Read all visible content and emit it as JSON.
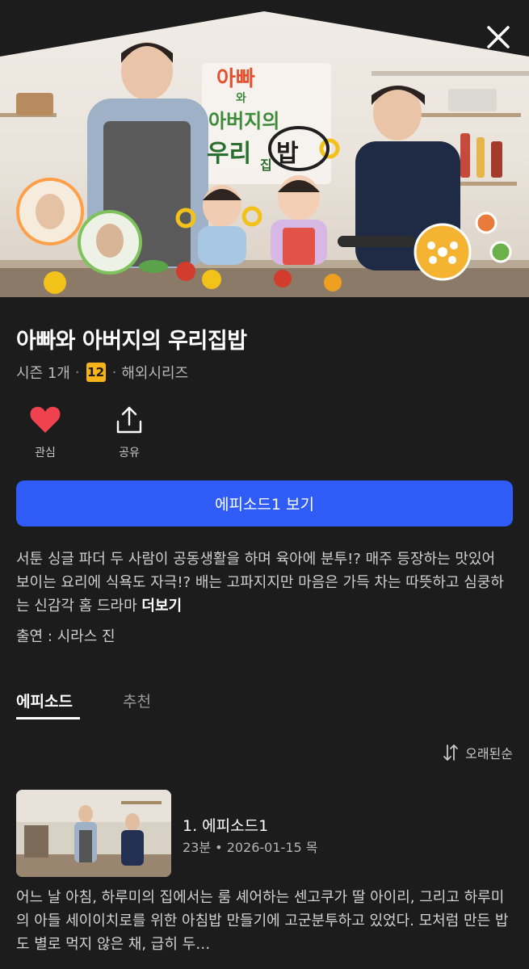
{
  "hero": {
    "logo_lines": [
      "아빠",
      "와",
      "아버지의",
      "우리",
      "집",
      "밥"
    ]
  },
  "show": {
    "title": "아빠와 아버지의 우리집밥",
    "seasons": "시즌 1개",
    "age_rating": "12",
    "category": "해외시리즈"
  },
  "actions": {
    "like_label": "관심",
    "share_label": "공유"
  },
  "play_button_label": "에피소드1 보기",
  "description": {
    "text": "서툰 싱글 파더 두 사람이 공동생활을 하며 육아에 분투!? 매주 등장하는 맛있어 보이는 요리에 식욕도 자극!? 배는 고파지지만 마음은 가득 차는 따뜻하고 심쿵하는 신감각 홈 드라마",
    "more_label": "더보기"
  },
  "cast": "출연 : 시라스 진",
  "tabs": [
    {
      "label": "에피소드",
      "active": true
    },
    {
      "label": "추천",
      "active": false
    }
  ],
  "sort_label": "오래된순",
  "episodes": [
    {
      "title": "1. 에피소드1",
      "meta": "23분 • 2026-01-15 목",
      "description": "어느 날 아침, 하루미의 집에서는 룸 셰어하는 센고쿠가 딸 아이리, 그리고 하루미의 아들 세이이치로를 위한 아침밥 만들기에 고군분투하고 있었다. 모처럼 만든 밥도 별로 먹지 않은 채, 급히 두…"
    }
  ],
  "colors": {
    "background": "#1c1c1c",
    "accent_blue": "#2f5cf6",
    "heart_red": "#f0414f",
    "age_badge": "#f5b31a"
  }
}
